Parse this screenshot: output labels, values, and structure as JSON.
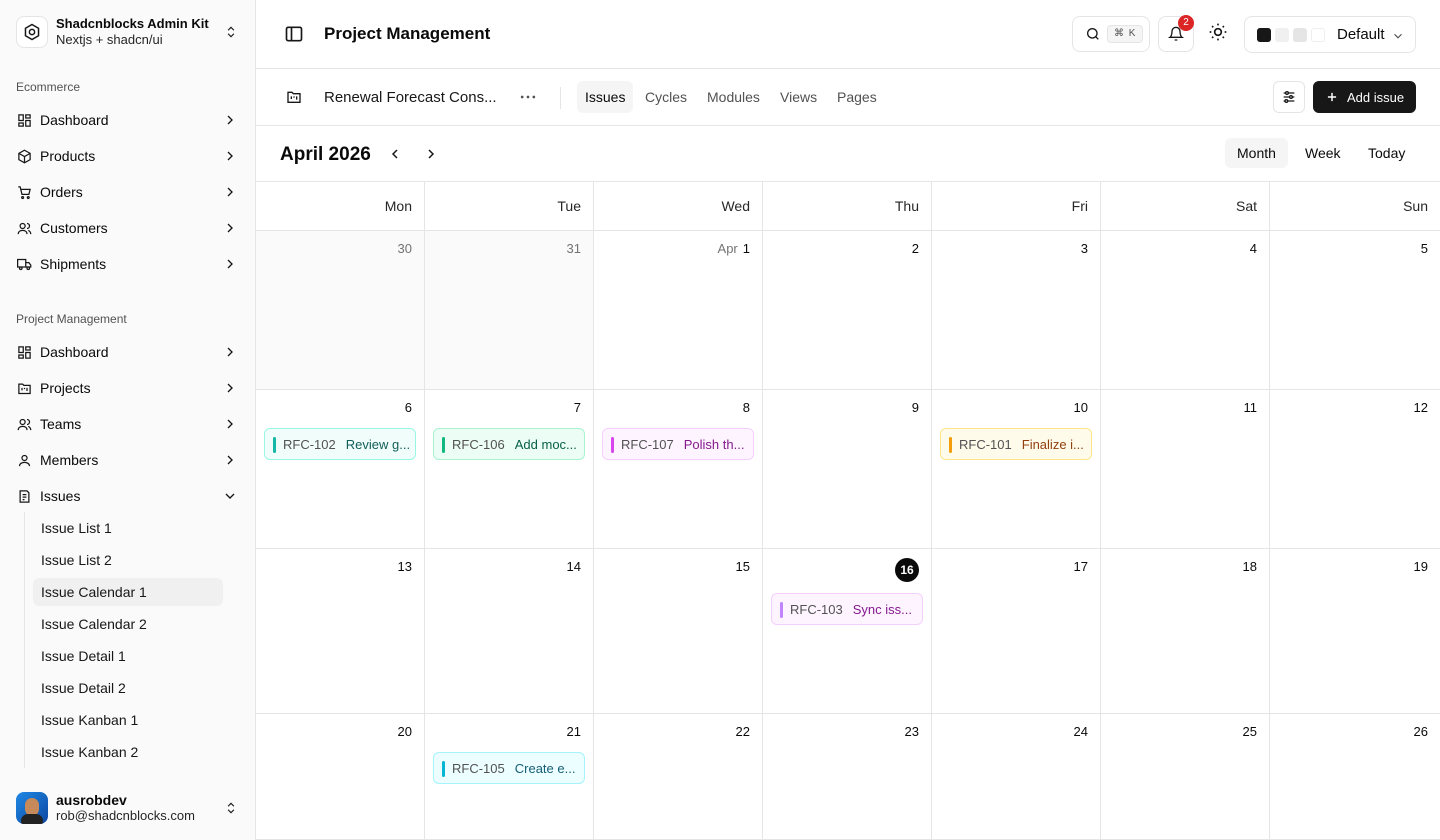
{
  "sidebar": {
    "brand": {
      "title": "Shadcnblocks Admin Kit",
      "subtitle": "Nextjs + shadcn/ui"
    },
    "groups": [
      {
        "label": "Ecommerce",
        "items": [
          {
            "label": "Dashboard",
            "icon": "layout-dashboard-icon"
          },
          {
            "label": "Products",
            "icon": "package-icon"
          },
          {
            "label": "Orders",
            "icon": "shopping-cart-icon"
          },
          {
            "label": "Customers",
            "icon": "users-icon"
          },
          {
            "label": "Shipments",
            "icon": "truck-icon"
          }
        ]
      },
      {
        "label": "Project Management",
        "items": [
          {
            "label": "Dashboard",
            "icon": "layout-dashboard-icon"
          },
          {
            "label": "Projects",
            "icon": "folder-kanban-icon"
          },
          {
            "label": "Teams",
            "icon": "users-icon"
          },
          {
            "label": "Members",
            "icon": "user-icon"
          },
          {
            "label": "Issues",
            "icon": "file-list-icon",
            "expanded": true
          }
        ]
      }
    ],
    "issues_sub": [
      "Issue List 1",
      "Issue List 2",
      "Issue Calendar 1",
      "Issue Calendar 2",
      "Issue Detail 1",
      "Issue Detail 2",
      "Issue Kanban 1",
      "Issue Kanban 2"
    ],
    "active_sub": "Issue Calendar 1",
    "user": {
      "name": "ausrobdev",
      "email": "rob@shadcnblocks.com"
    }
  },
  "header": {
    "title": "Project Management",
    "search_kbd": "⌘ K",
    "notifications_count": "2",
    "theme": {
      "label": "Default",
      "swatches": [
        "#171717",
        "#f0f0f0",
        "#e5e5e5",
        "#ffffff"
      ]
    }
  },
  "project": {
    "name": "Renewal Forecast Cons...",
    "tabs": [
      "Issues",
      "Cycles",
      "Modules",
      "Views",
      "Pages"
    ],
    "active_tab": "Issues",
    "add_issue_label": "Add issue"
  },
  "calendar": {
    "month_title": "April 2026",
    "views": [
      "Month",
      "Week",
      "Today"
    ],
    "active_view": "Month",
    "weekdays": [
      "Mon",
      "Tue",
      "Wed",
      "Thu",
      "Fri",
      "Sat",
      "Sun"
    ],
    "weeks": [
      [
        "30",
        "31",
        "1",
        "2",
        "3",
        "4",
        "5"
      ],
      [
        "6",
        "7",
        "8",
        "9",
        "10",
        "11",
        "12"
      ],
      [
        "13",
        "14",
        "15",
        "16",
        "17",
        "18",
        "19"
      ],
      [
        "20",
        "21",
        "22",
        "23",
        "24",
        "25",
        "26"
      ]
    ],
    "apr1_prefix": "Apr",
    "today": "16",
    "events": [
      {
        "key": "RFC-102",
        "title": "Review g...",
        "week": 1,
        "day": 0,
        "accent": "#14b8a6",
        "bg": "#f0fdfa",
        "border": "#99f6e4",
        "text": "#115e59"
      },
      {
        "key": "RFC-106",
        "title": "Add moc...",
        "week": 1,
        "day": 1,
        "accent": "#10b981",
        "bg": "#ecfdf5",
        "border": "#a7f3d0",
        "text": "#065f46"
      },
      {
        "key": "RFC-107",
        "title": "Polish th...",
        "week": 1,
        "day": 2,
        "accent": "#d946ef",
        "bg": "#fdf4ff",
        "border": "#f5d0fe",
        "text": "#86198f"
      },
      {
        "key": "RFC-101",
        "title": "Finalize i...",
        "week": 1,
        "day": 4,
        "accent": "#f59e0b",
        "bg": "#fffbeb",
        "border": "#fde68a",
        "text": "#92400e"
      },
      {
        "key": "RFC-103",
        "title": "Sync iss...",
        "week": 2,
        "day": 3,
        "accent": "#c084fc",
        "bg": "#fdf4ff",
        "border": "#f5d0fe",
        "text": "#86198f"
      },
      {
        "key": "RFC-105",
        "title": "Create e...",
        "week": 3,
        "day": 1,
        "accent": "#06b6d4",
        "bg": "#ecfeff",
        "border": "#a5f3fc",
        "text": "#155e75"
      }
    ]
  }
}
